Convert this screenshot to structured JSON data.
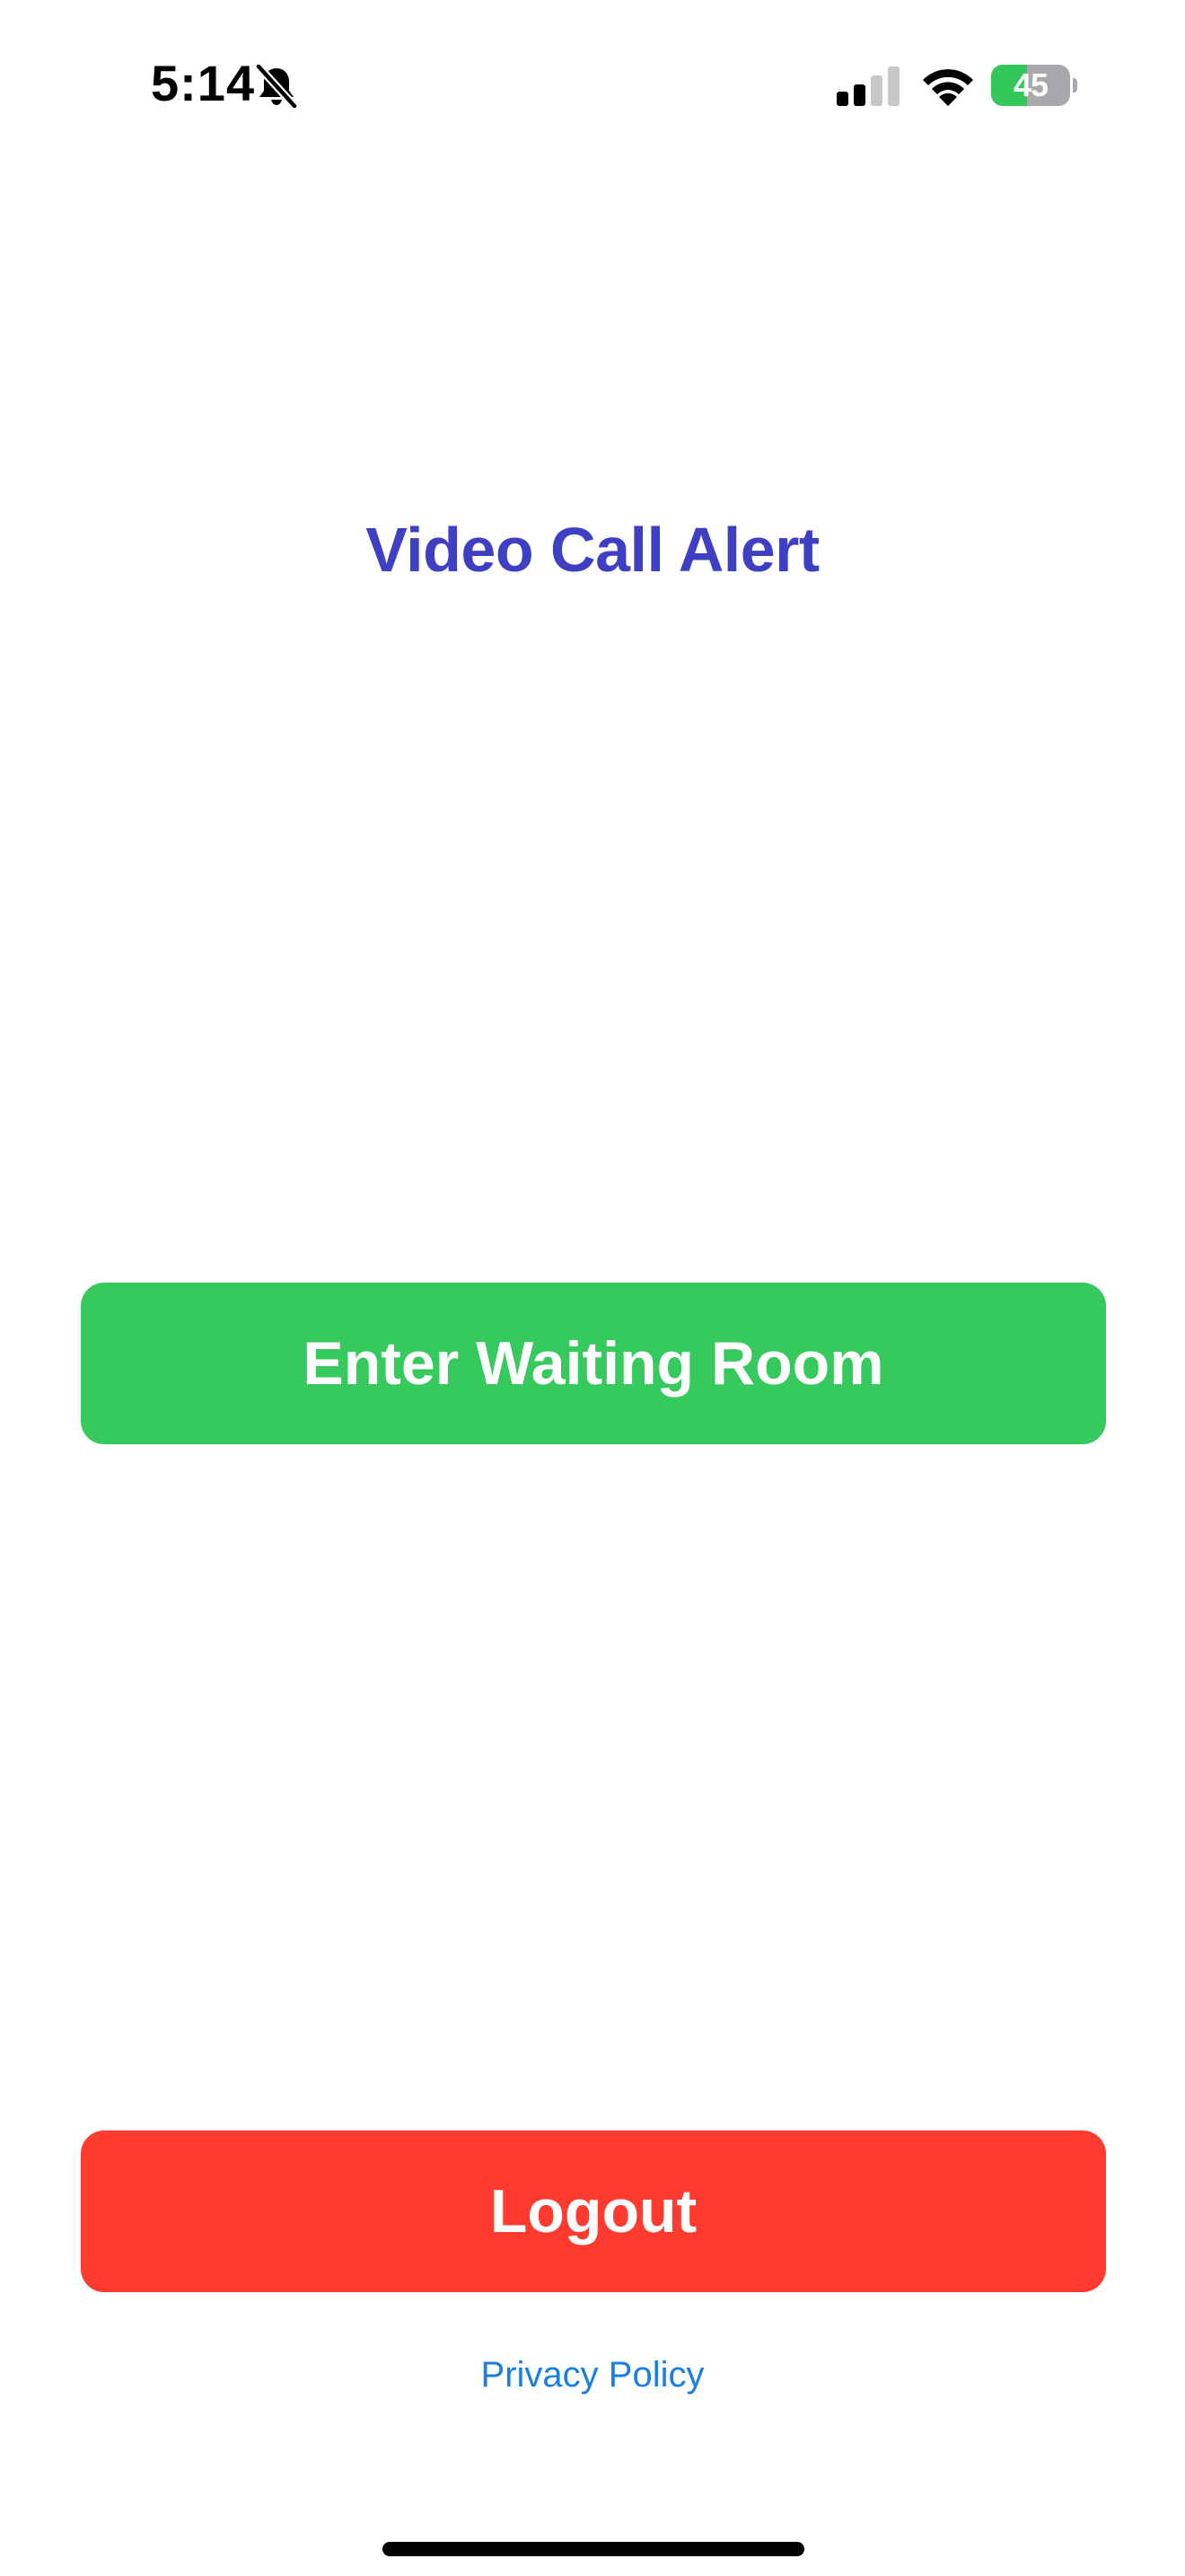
{
  "status_bar": {
    "time": "5:14",
    "mute_icon": "bell-slash-icon",
    "signal_icon": "cellular-signal-icon",
    "signal_bars_active": 2,
    "signal_bars_total": 4,
    "wifi_icon": "wifi-icon",
    "battery_icon": "battery-charging-icon",
    "battery_level": "45",
    "battery_level_fraction": 0.45,
    "battery_fill_color": "#34c759"
  },
  "main": {
    "title": "Video Call Alert",
    "title_color": "#3f3fc4",
    "enter_button_label": "Enter Waiting Room",
    "enter_button_color": "#36c95d"
  },
  "footer": {
    "logout_label": "Logout",
    "logout_color": "#ff3b30",
    "privacy_link": "Privacy Policy",
    "privacy_link_color": "#1a7fe0"
  }
}
